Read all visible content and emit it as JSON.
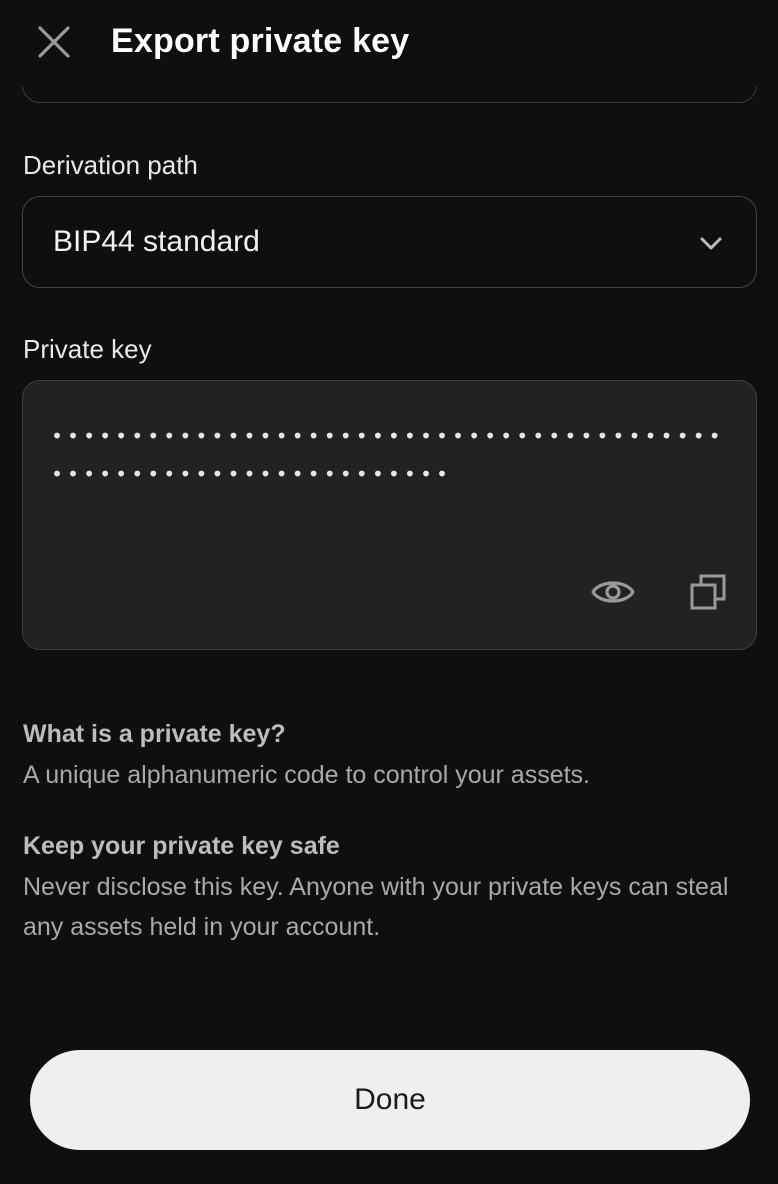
{
  "header": {
    "title": "Export private key",
    "close_icon": "close-icon"
  },
  "derivation": {
    "label": "Derivation path",
    "selected": "BIP44 standard",
    "chevron_icon": "chevron-down-icon"
  },
  "private_key": {
    "label": "Private key",
    "masked_value": "•••••••••••••••••••••••••••••••••••••••••••••••••••••••••••••••••••",
    "eye_icon": "eye-icon",
    "copy_icon": "copy-icon"
  },
  "info": {
    "what_heading": "What is a private key?",
    "what_text": "A unique alphanumeric code to control your assets.",
    "safe_heading": "Keep your private key safe",
    "safe_text": "Never disclose this key. Anyone with your private keys can steal any assets held in your account."
  },
  "footer": {
    "done_label": "Done"
  },
  "colors": {
    "background": "#0f0f0f",
    "key_box": "#222222",
    "button": "#efefef"
  }
}
